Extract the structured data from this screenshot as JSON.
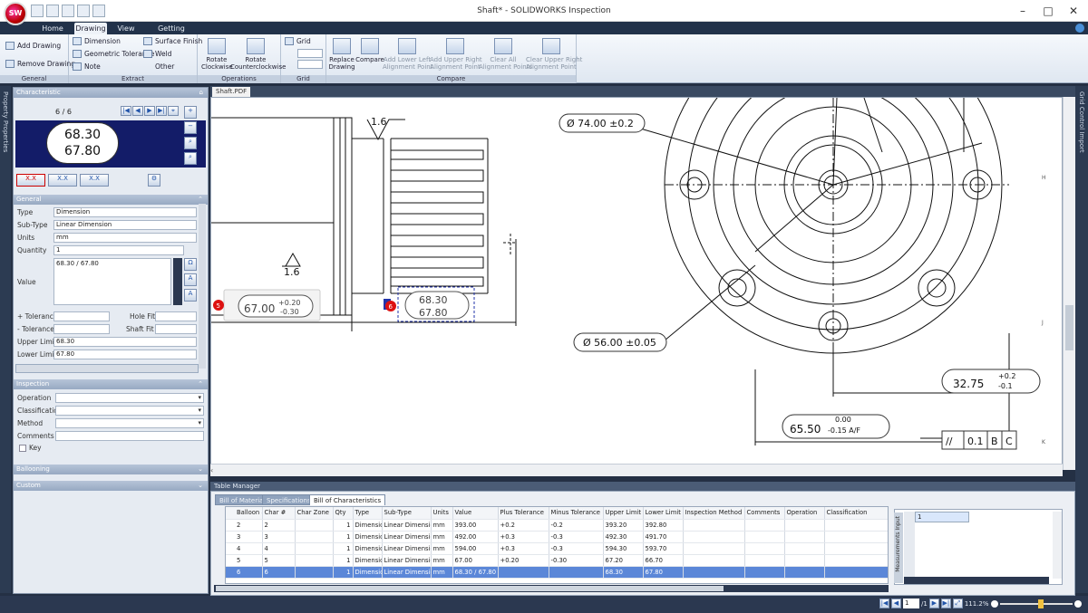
{
  "window": {
    "title": "Shaft* - SOLIDWORKS Inspection",
    "logo_text": "SW",
    "minimize": "–",
    "maximize": "□",
    "close": "✕"
  },
  "ribbon_tabs": [
    "Home",
    "Drawing",
    "View",
    "Getting Started"
  ],
  "active_tab": "Drawing",
  "ribbon": {
    "general": {
      "label": "General",
      "add_drawing": "Add Drawing",
      "remove_drawing": "Remove Drawing"
    },
    "extract": {
      "label": "Extract",
      "dimension": "Dimension",
      "geometric_tolerance": "Geometric Tolerance",
      "note": "Note",
      "surface_finish": "Surface Finish",
      "weld": "Weld",
      "other": "Other"
    },
    "operations": {
      "label": "Operations",
      "rotate_cw": "Rotate\nClockwise",
      "rotate_ccw": "Rotate\nCounterclockwise"
    },
    "grid": {
      "label": "Grid",
      "grid": "Grid"
    },
    "compare": {
      "label": "Compare",
      "replace_drawing": "Replace\nDrawing",
      "compare": "Compare",
      "add_lower_left": "Add Lower Left\nAlignment Point",
      "add_upper_right": "Add Upper Right\nAlignment Point",
      "clear_all": "Clear All\nAlignment Points",
      "clear_upper_right": "Clear Upper Right\nAlignment Point"
    }
  },
  "side_labels": {
    "left": "Property Properties",
    "right": "Grid Control Import"
  },
  "panel": {
    "title": "Characteristic",
    "counter": "6 / 6",
    "bubble_upper": "68.30",
    "bubble_lower": "67.80",
    "general": {
      "header": "General",
      "type_label": "Type",
      "type_value": "Dimension",
      "subtype_label": "Sub-Type",
      "subtype_value": "Linear Dimension",
      "units_label": "Units",
      "units_value": "mm",
      "quantity_label": "Quantity",
      "quantity_value": "1",
      "value_label": "Value",
      "value_value": "68.30 / 67.80",
      "plus_tol_label": "+ Tolerance",
      "minus_tol_label": "- Tolerance",
      "hole_fit_label": "Hole Fit",
      "shaft_fit_label": "Shaft Fit",
      "upper_limit_label": "Upper Limit",
      "upper_limit_value": "68.30",
      "lower_limit_label": "Lower Limit",
      "lower_limit_value": "67.80"
    },
    "inspection": {
      "header": "Inspection",
      "operation_label": "Operation",
      "classification_label": "Classification",
      "method_label": "Method",
      "comments_label": "Comments",
      "key_label": "Key"
    },
    "ballooning": "Ballooning",
    "custom": "Custom"
  },
  "drawing_tab": "Shaft.PDF",
  "drawing": {
    "d1": "Ø 74.00 ±0.2",
    "d2": "Ø 56.00 ±0.05",
    "d3_main": "32.75",
    "d3_plus": "+0.2",
    "d3_minus": "-0.1",
    "d4_main": "65.50",
    "d4_upper": "0.00",
    "d4_lower": "-0.15 A/F",
    "fcf": [
      "//",
      "0.1",
      "B",
      "C"
    ],
    "sf1": "1.6",
    "sf2": "1.6",
    "b5_main": "67.00",
    "b5_plus": "+0.20",
    "b5_minus": "-0.30",
    "b6_upper": "68.30",
    "b6_lower": "67.80",
    "balloon5": "5",
    "balloon6": "6",
    "zone_h": "H",
    "zone_j": "J",
    "zone_k": "K"
  },
  "table_manager": {
    "title": "Table Manager",
    "tabs": [
      "Bill of Material",
      "Specifications",
      "Bill of Characteristics"
    ],
    "active_tab": "Bill of Characteristics",
    "columns": [
      "Balloon #",
      "Char #",
      "Char Zone",
      "Qty",
      "Type",
      "Sub-Type",
      "Units",
      "Value",
      "Plus Tolerance",
      "Minus Tolerance",
      "Upper Limit",
      "Lower Limit",
      "Inspection Method",
      "Comments",
      "Operation",
      "Classification"
    ],
    "rows": [
      {
        "balloon": "2",
        "char": "2",
        "zone": "",
        "qty": "1",
        "type": "Dimension",
        "subtype": "Linear Dimension",
        "units": "mm",
        "value": "393.00",
        "plus": "+0.2",
        "minus": "-0.2",
        "upper": "393.20",
        "lower": "392.80"
      },
      {
        "balloon": "3",
        "char": "3",
        "zone": "",
        "qty": "1",
        "type": "Dimension",
        "subtype": "Linear Dimension",
        "units": "mm",
        "value": "492.00",
        "plus": "+0.3",
        "minus": "-0.3",
        "upper": "492.30",
        "lower": "491.70"
      },
      {
        "balloon": "4",
        "char": "4",
        "zone": "",
        "qty": "1",
        "type": "Dimension",
        "subtype": "Linear Dimension",
        "units": "mm",
        "value": "594.00",
        "plus": "+0.3",
        "minus": "-0.3",
        "upper": "594.30",
        "lower": "593.70"
      },
      {
        "balloon": "5",
        "char": "5",
        "zone": "",
        "qty": "1",
        "type": "Dimension",
        "subtype": "Linear Dimension",
        "units": "mm",
        "value": "67.00",
        "plus": "+0.20",
        "minus": "-0.30",
        "upper": "67.20",
        "lower": "66.70"
      },
      {
        "balloon": "6",
        "char": "6",
        "zone": "",
        "qty": "1",
        "type": "Dimension",
        "subtype": "Linear Dimension",
        "units": "mm",
        "value": "68.30 / 67.80",
        "plus": "",
        "minus": "",
        "upper": "68.30",
        "lower": "67.80"
      }
    ],
    "measurement_label": "Measurements Input",
    "measurement_first": "1"
  },
  "status": {
    "page": "1",
    "page_total": "/1",
    "zoom": "111.2%"
  },
  "colors": {
    "accent": "#5b87d8",
    "dark": "#243044",
    "balloon": "#d11111",
    "bubble_bg": "#131c68"
  }
}
